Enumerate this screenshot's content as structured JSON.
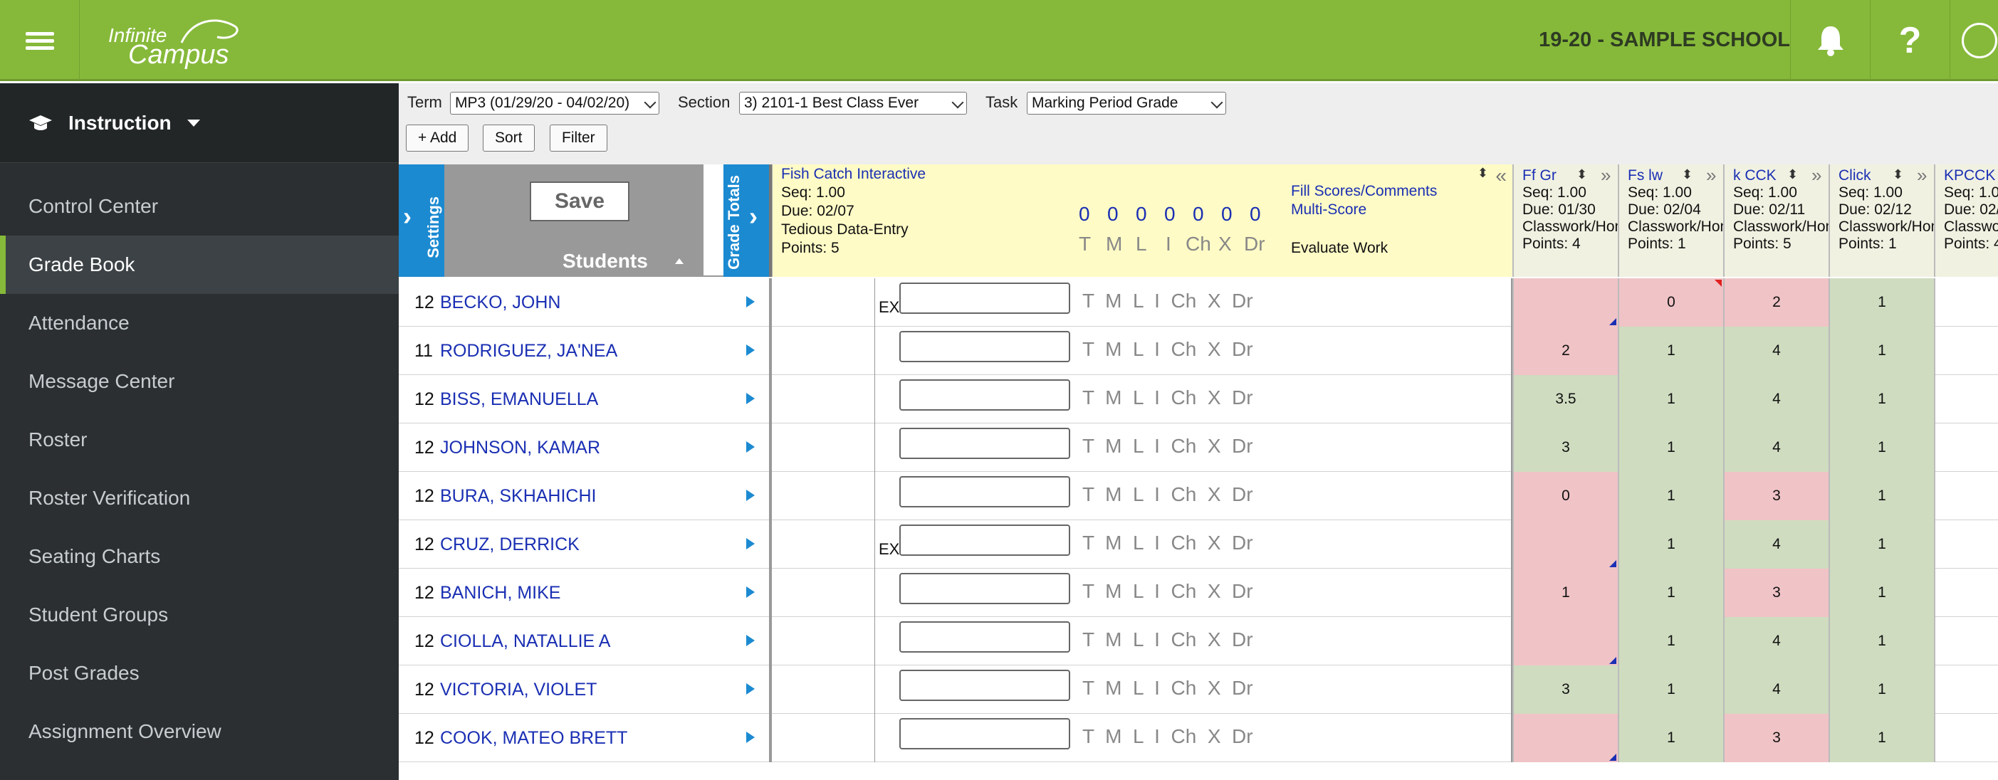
{
  "app": {
    "logo_line1": "Infinite",
    "logo_line2": "Campus",
    "school": "19-20 - SAMPLE SCHOOL"
  },
  "sidebar": {
    "section": "Instruction",
    "items": [
      {
        "label": "Control Center",
        "active": false
      },
      {
        "label": "Grade Book",
        "active": true
      },
      {
        "label": "Attendance",
        "active": false
      },
      {
        "label": "Message Center",
        "active": false
      },
      {
        "label": "Roster",
        "active": false
      },
      {
        "label": "Roster Verification",
        "active": false
      },
      {
        "label": "Seating Charts",
        "active": false
      },
      {
        "label": "Student Groups",
        "active": false
      },
      {
        "label": "Post Grades",
        "active": false
      },
      {
        "label": "Assignment Overview",
        "active": false
      }
    ]
  },
  "toolbar": {
    "term_label": "Term",
    "term_value": "MP3 (01/29/20 - 04/02/20)",
    "section_label": "Section",
    "section_value": "3) 2101-1 Best Class Ever",
    "task_label": "Task",
    "task_value": "Marking Period Grade",
    "add_label": "+ Add",
    "sort_label": "Sort",
    "filter_label": "Filter"
  },
  "grid": {
    "settings_label": "Settings",
    "save_label": "Save",
    "students_label": "Students",
    "grade_totals_label": "Grade Totals",
    "assignment": {
      "name": "Fish Catch Interactive",
      "seq": "Seq: 1.00",
      "due": "Due: 02/07",
      "category": "Tedious Data-Entry",
      "points": "Points: 5",
      "counts": [
        "0",
        "0",
        "0",
        "0",
        "0",
        "0",
        "0"
      ],
      "flag_codes": [
        "T",
        "M",
        "L",
        "I",
        "Ch",
        "X",
        "Dr"
      ],
      "fill_link": "Fill Scores/Comments",
      "multi_link": "Multi-Score",
      "evaluate": "Evaluate Work"
    },
    "columns": [
      {
        "name": "Ff Gr",
        "seq": "Seq: 1.00",
        "due": "Due: 01/30",
        "cat": "Classwork/Homework",
        "points": "Points: 4"
      },
      {
        "name": "Fs lw",
        "seq": "Seq: 1.00",
        "due": "Due: 02/04",
        "cat": "Classwork/Homework",
        "points": "Points: 1"
      },
      {
        "name": "k CCK",
        "seq": "Seq: 1.00",
        "due": "Due: 02/11",
        "cat": "Classwork/Homework",
        "points": "Points: 5"
      },
      {
        "name": "Click",
        "seq": "Seq: 1.00",
        "due": "Due: 02/12",
        "cat": "Classwork/Homework",
        "points": "Points: 1"
      },
      {
        "name": "KPCCK",
        "seq": "Seq: 1.00",
        "due": "Due: 02/",
        "cat": "Classwork",
        "points": "Points: 4"
      }
    ],
    "flags_text": "T  M  L  I  Ch  X  Dr",
    "rows": [
      {
        "grade": "12",
        "name": "BECKO, JOHN",
        "ex": "EX",
        "scores": [
          "",
          "0",
          "2",
          "1",
          ""
        ]
      },
      {
        "grade": "11",
        "name": "RODRIGUEZ, JA'NEA",
        "ex": "",
        "scores": [
          "2",
          "1",
          "4",
          "1",
          ""
        ]
      },
      {
        "grade": "12",
        "name": "BISS, EMANUELLA",
        "ex": "",
        "scores": [
          "3.5",
          "1",
          "4",
          "1",
          ""
        ]
      },
      {
        "grade": "12",
        "name": "JOHNSON, KAMAR",
        "ex": "",
        "scores": [
          "3",
          "1",
          "4",
          "1",
          ""
        ]
      },
      {
        "grade": "12",
        "name": "BURA, SKHAHICHI",
        "ex": "",
        "scores": [
          "0",
          "1",
          "3",
          "1",
          ""
        ]
      },
      {
        "grade": "12",
        "name": "CRUZ, DERRICK",
        "ex": "EX",
        "scores": [
          "",
          "1",
          "4",
          "1",
          ""
        ]
      },
      {
        "grade": "12",
        "name": "BANICH, MIKE",
        "ex": "",
        "scores": [
          "1",
          "1",
          "3",
          "1",
          ""
        ]
      },
      {
        "grade": "12",
        "name": "CIOLLA, NATALLIE A",
        "ex": "",
        "scores": [
          "",
          "1",
          "4",
          "1",
          ""
        ]
      },
      {
        "grade": "12",
        "name": "VICTORIA, VIOLET",
        "ex": "",
        "scores": [
          "3",
          "1",
          "4",
          "1",
          ""
        ]
      },
      {
        "grade": "12",
        "name": "COOK, MATEO BRETT",
        "ex": "",
        "scores": [
          "",
          "1",
          "3",
          "1",
          ""
        ]
      }
    ]
  },
  "colors": {
    "brand": "#86b93a",
    "sidebar": "#2b2f31",
    "accent": "#1c8ad1",
    "pink": "#f0c3c6",
    "green": "#cfdcc0"
  }
}
